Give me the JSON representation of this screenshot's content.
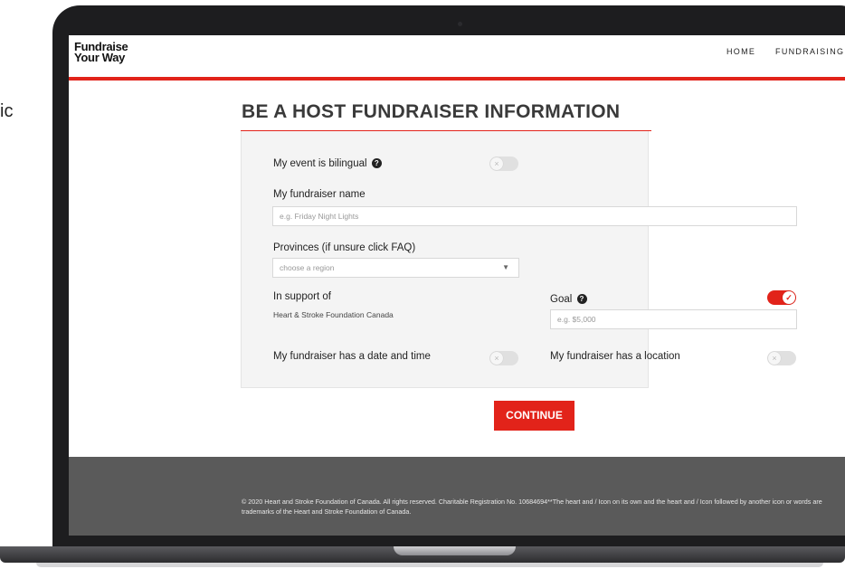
{
  "stray_text": "ic",
  "nav": {
    "logo_line1": "Fundraise",
    "logo_line2": "Your Way",
    "links": [
      "HOME",
      "FUNDRAISING I"
    ]
  },
  "page": {
    "title": "BE A HOST FUNDRAISER INFORMATION"
  },
  "form": {
    "bilingual_label": "My event is bilingual",
    "bilingual_toggle": "off",
    "name_label": "My fundraiser name",
    "name_placeholder": "e.g. Friday Night Lights",
    "provinces_label": "Provinces (if unsure click FAQ)",
    "provinces_value": "choose a region",
    "support_label": "In support of",
    "support_value": "Heart & Stroke Foundation Canada",
    "goal_label": "Goal",
    "goal_toggle": "on",
    "goal_placeholder": "e.g. $5,000",
    "date_time_label": "My fundraiser has a date and time",
    "date_time_toggle": "off",
    "location_label": "My fundraiser has a location",
    "location_toggle": "off"
  },
  "actions": {
    "continue_label": "CONTINUE"
  },
  "footer": {
    "text": "© 2020 Heart and Stroke Foundation of Canada. All rights reserved. Charitable Registration No. 10684694**The heart and / Icon on its own and the heart and / Icon followed by another icon or words are trademarks of the Heart and Stroke Foundation of Canada."
  },
  "colors": {
    "brand_red": "#e2231a",
    "panel_bg": "#f4f4f4",
    "footer_bg": "#5a5a5a"
  },
  "icons": {
    "help": "question-circle-icon",
    "toggle_off": "x-icon",
    "toggle_on": "check-icon",
    "dropdown": "chevron-down-icon"
  }
}
